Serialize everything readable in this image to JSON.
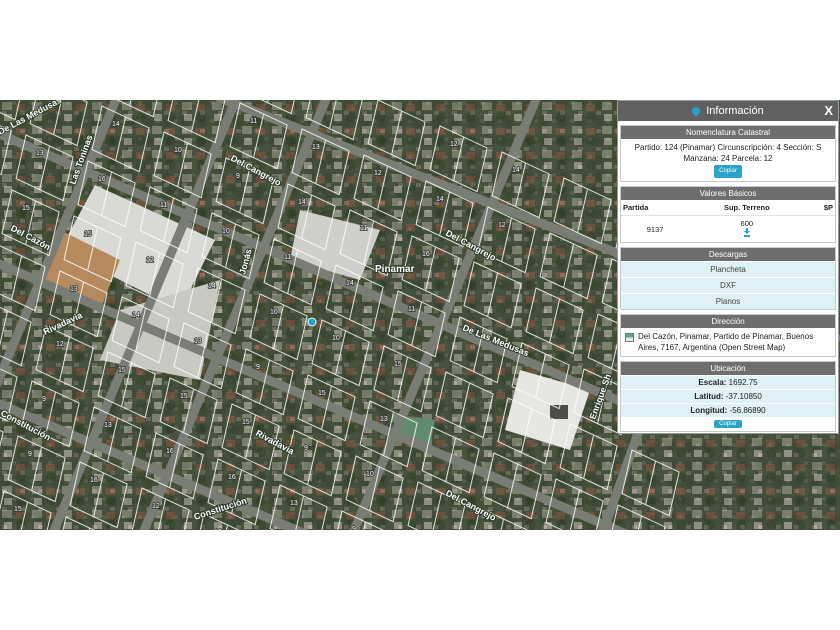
{
  "panel": {
    "title": "Información",
    "close": "X",
    "nomenclatura": {
      "header": "Nomenclatura Catastral",
      "line1": "Partido: 124 (Pinamar) Circunscripción: 4 Sección: S",
      "line2": "Manzana: 24 Parcela: 12",
      "copy": "Copiar"
    },
    "valores": {
      "header": "Valores Básicos",
      "columns": [
        "Partida",
        "Sup. Terreno",
        "$P"
      ],
      "row": [
        "9137",
        "600",
        ""
      ]
    },
    "descargas": {
      "header": "Descargas",
      "items": [
        "Plancheta",
        "DXF",
        "Planos"
      ]
    },
    "direccion": {
      "header": "Dirección",
      "text": "Del Cazón, Pinamar, Partido de Pinamar, Buenos Aires, 7167, Argentina (Open Street Map)"
    },
    "ubicacion": {
      "header": "Ubicación",
      "escala_label": "Escala:",
      "escala": "1692.75",
      "latitud_label": "Latitud:",
      "latitud": "-37.10850",
      "longitud_label": "Longitud:",
      "longitud": "-56.86890",
      "copy": "Copiar"
    }
  },
  "map": {
    "streets": [
      "Del Cangrejo",
      "De Las Medusas",
      "Del Cazón",
      "Rivadavia",
      "De Las Medusas",
      "Del Cangrejo",
      "Rivadavia",
      "Constitución",
      "Constitución",
      "Jonás",
      "Enrique Sh",
      "Las Toninas",
      "Del Cangrejo"
    ],
    "locality": "Pinamar",
    "parcel_numbers": [
      "13",
      "15",
      "14",
      "16",
      "15",
      "13",
      "12",
      "9",
      "9",
      "15",
      "10",
      "11",
      "12",
      "14",
      "15",
      "13",
      "16",
      "12",
      "11",
      "9",
      "10",
      "14",
      "13",
      "15",
      "16",
      "12",
      "13",
      "14",
      "11",
      "10",
      "9",
      "15",
      "16",
      "13",
      "12",
      "11",
      "14",
      "10",
      "15",
      "9",
      "13",
      "12",
      "14",
      "16",
      "11",
      "15",
      "13",
      "10",
      "9",
      "14",
      "12"
    ]
  },
  "colors": {
    "panel_header": "#606060",
    "section_header": "#6e6e6e",
    "accent": "#2aa3c8",
    "row_bg": "#dff0f6",
    "parcel_lines": "#ffffff"
  }
}
